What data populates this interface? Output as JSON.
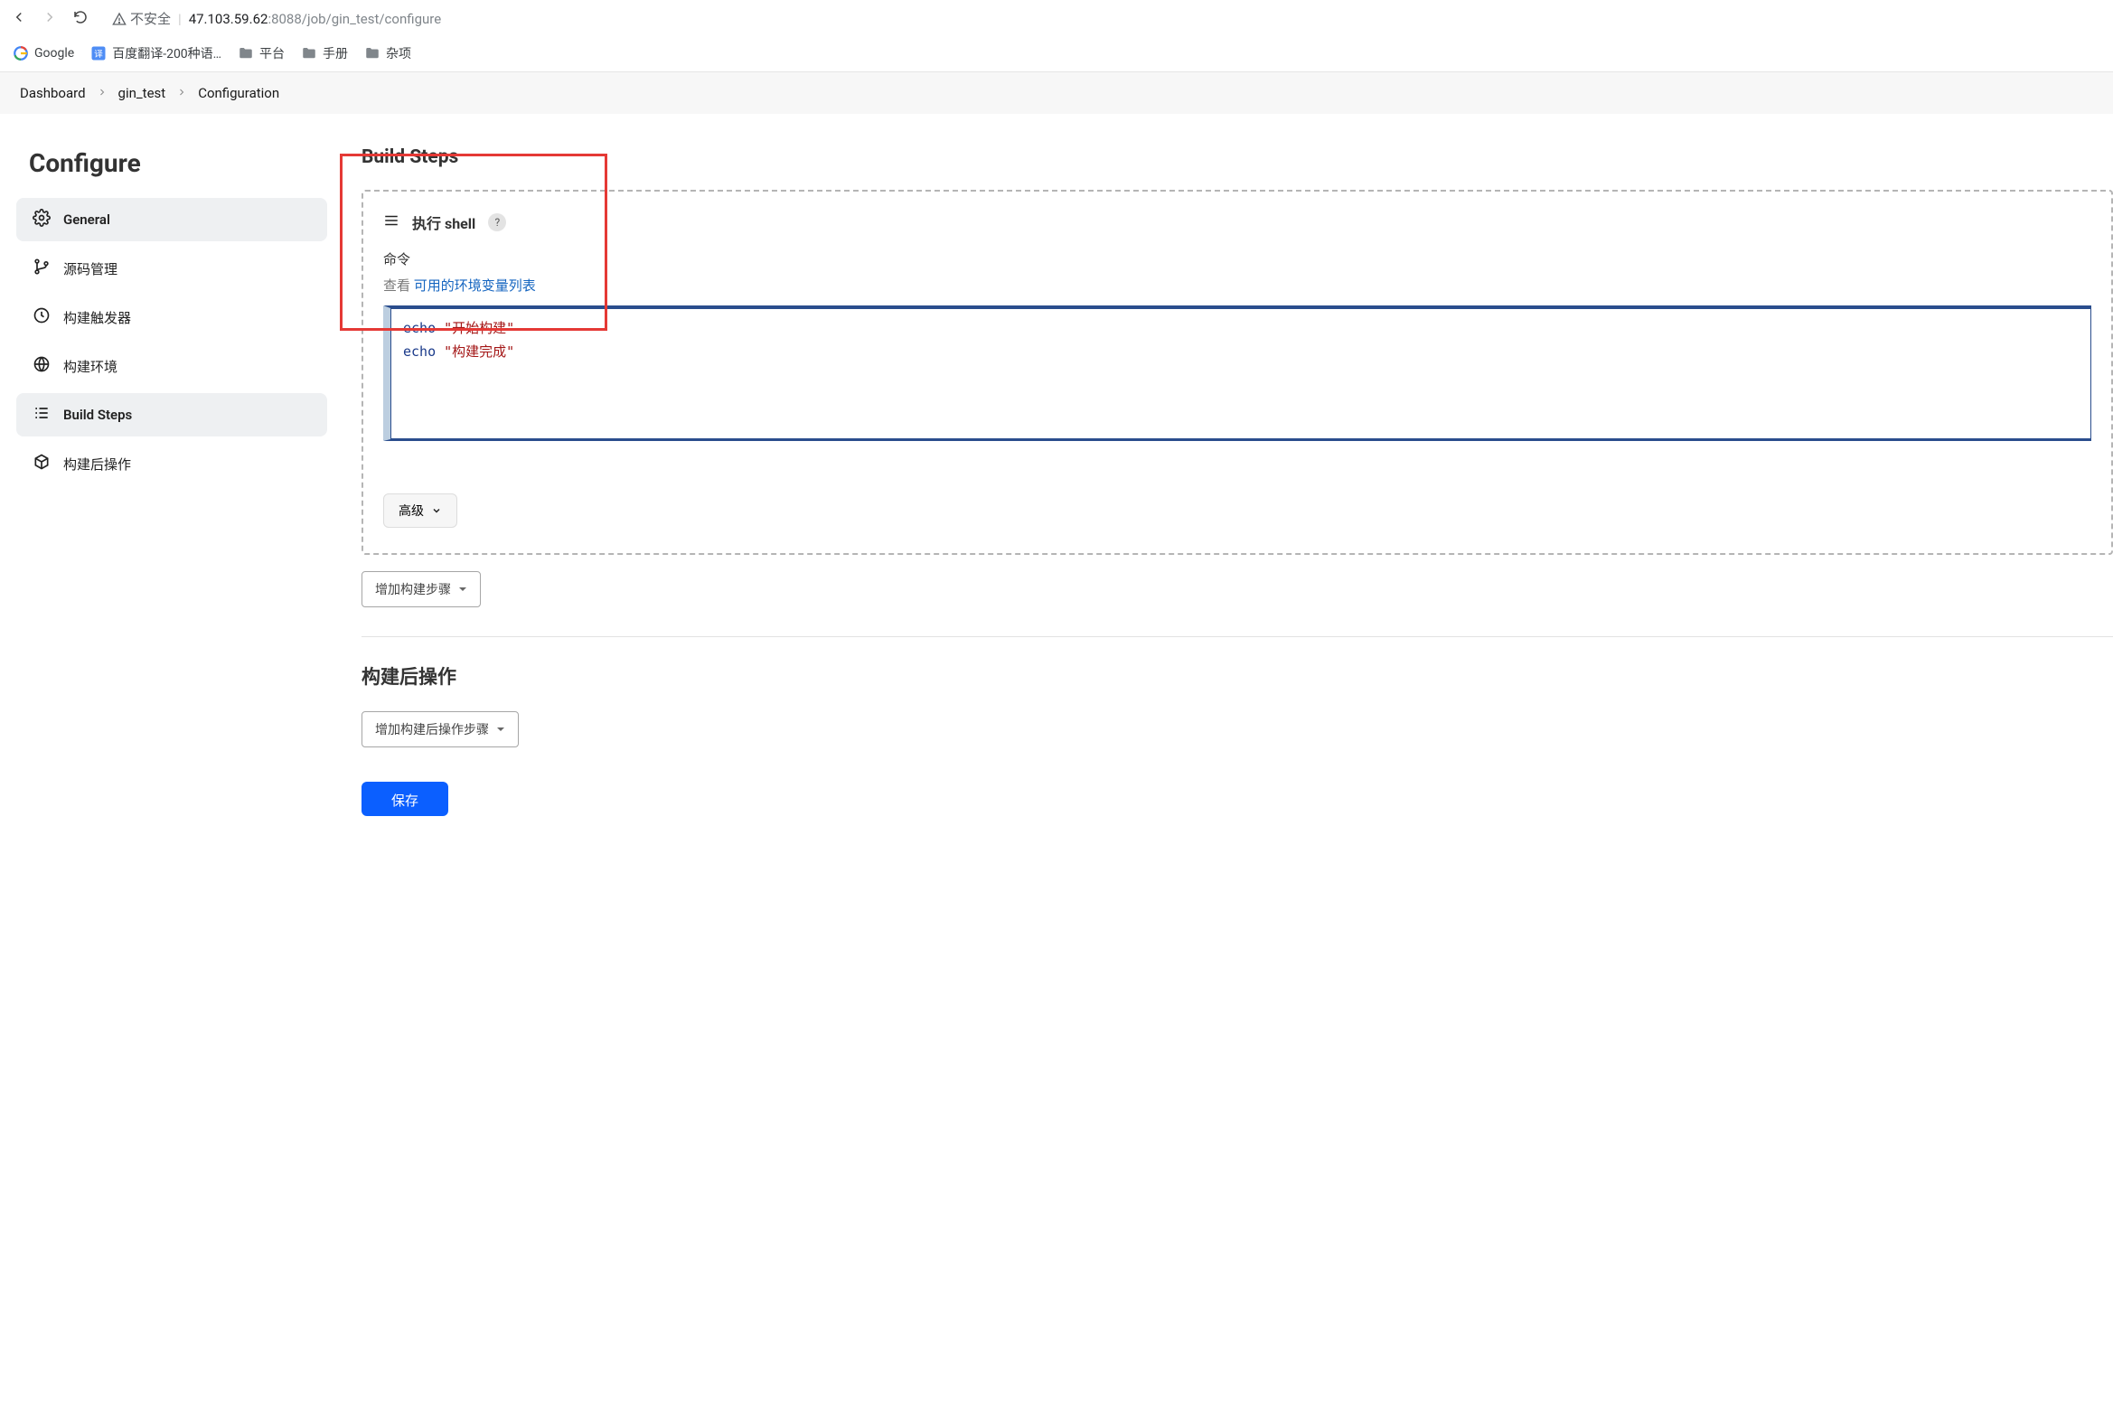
{
  "browser": {
    "insecure_label": "不安全",
    "url_host": "47.103.59.62",
    "url_port": ":8088",
    "url_path": "/job/gin_test/configure"
  },
  "bookmarks": {
    "google": "Google",
    "baidu_translate": "百度翻译-200种语…",
    "platform": "平台",
    "manual": "手册",
    "misc": "杂项"
  },
  "breadcrumb": {
    "dashboard": "Dashboard",
    "job": "gin_test",
    "page": "Configuration"
  },
  "sidebar": {
    "title": "Configure",
    "items": [
      {
        "key": "general",
        "label": "General"
      },
      {
        "key": "scm",
        "label": "源码管理"
      },
      {
        "key": "triggers",
        "label": "构建触发器"
      },
      {
        "key": "env",
        "label": "构建环境"
      },
      {
        "key": "steps",
        "label": "Build Steps"
      },
      {
        "key": "post",
        "label": "构建后操作"
      }
    ]
  },
  "main": {
    "build_steps_title": "Build Steps",
    "shell_step": {
      "title": "执行 shell",
      "command_label": "命令",
      "hint_prefix": "查看 ",
      "hint_link": "可用的环境变量列表",
      "code_lines": [
        {
          "cmd": "echo",
          "str": "\"开始构建\""
        },
        {
          "cmd": "echo",
          "str": "\"构建完成\""
        }
      ],
      "advanced_label": "高级"
    },
    "add_step_btn": "增加构建步骤",
    "post_section_title": "构建后操作",
    "add_post_btn": "增加构建后操作步骤",
    "save_btn": "保存"
  }
}
